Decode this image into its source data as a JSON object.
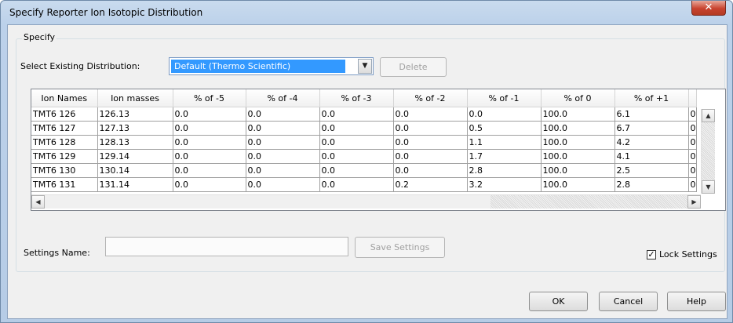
{
  "window": {
    "title": "Specify Reporter Ion Isotopic Distribution",
    "close_glyph": "✕"
  },
  "group": {
    "label": "Specify"
  },
  "select_distribution": {
    "label": "Select Existing Distribution:",
    "value": "Default (Thermo Scientific)",
    "arrow": "▼"
  },
  "buttons": {
    "delete": "Delete",
    "save_settings": "Save Settings",
    "ok": "OK",
    "cancel": "Cancel",
    "help": "Help"
  },
  "table": {
    "headers": [
      "Ion Names",
      "Ion masses",
      "% of -5",
      "% of -4",
      "% of -3",
      "% of -2",
      "% of -1",
      "% of 0",
      "% of +1",
      ""
    ],
    "rows": [
      [
        "TMT6 126",
        "126.13",
        "0.0",
        "0.0",
        "0.0",
        "0.0",
        "0.0",
        "100.0",
        "6.1",
        "0"
      ],
      [
        "TMT6 127",
        "127.13",
        "0.0",
        "0.0",
        "0.0",
        "0.0",
        "0.5",
        "100.0",
        "6.7",
        "0"
      ],
      [
        "TMT6 128",
        "128.13",
        "0.0",
        "0.0",
        "0.0",
        "0.0",
        "1.1",
        "100.0",
        "4.2",
        "0"
      ],
      [
        "TMT6 129",
        "129.14",
        "0.0",
        "0.0",
        "0.0",
        "0.0",
        "1.7",
        "100.0",
        "4.1",
        "0"
      ],
      [
        "TMT6 130",
        "130.14",
        "0.0",
        "0.0",
        "0.0",
        "0.0",
        "2.8",
        "100.0",
        "2.5",
        "0"
      ],
      [
        "TMT6 131",
        "131.14",
        "0.0",
        "0.0",
        "0.0",
        "0.2",
        "3.2",
        "100.0",
        "2.8",
        "0"
      ]
    ]
  },
  "scroll": {
    "up": "▲",
    "down": "▼",
    "left": "◀",
    "right": "▶"
  },
  "settings_name": {
    "label": "Settings Name:",
    "value": "",
    "placeholder": ""
  },
  "lock_settings": {
    "label": "Lock Settings",
    "checked": true,
    "mark": "✓"
  }
}
